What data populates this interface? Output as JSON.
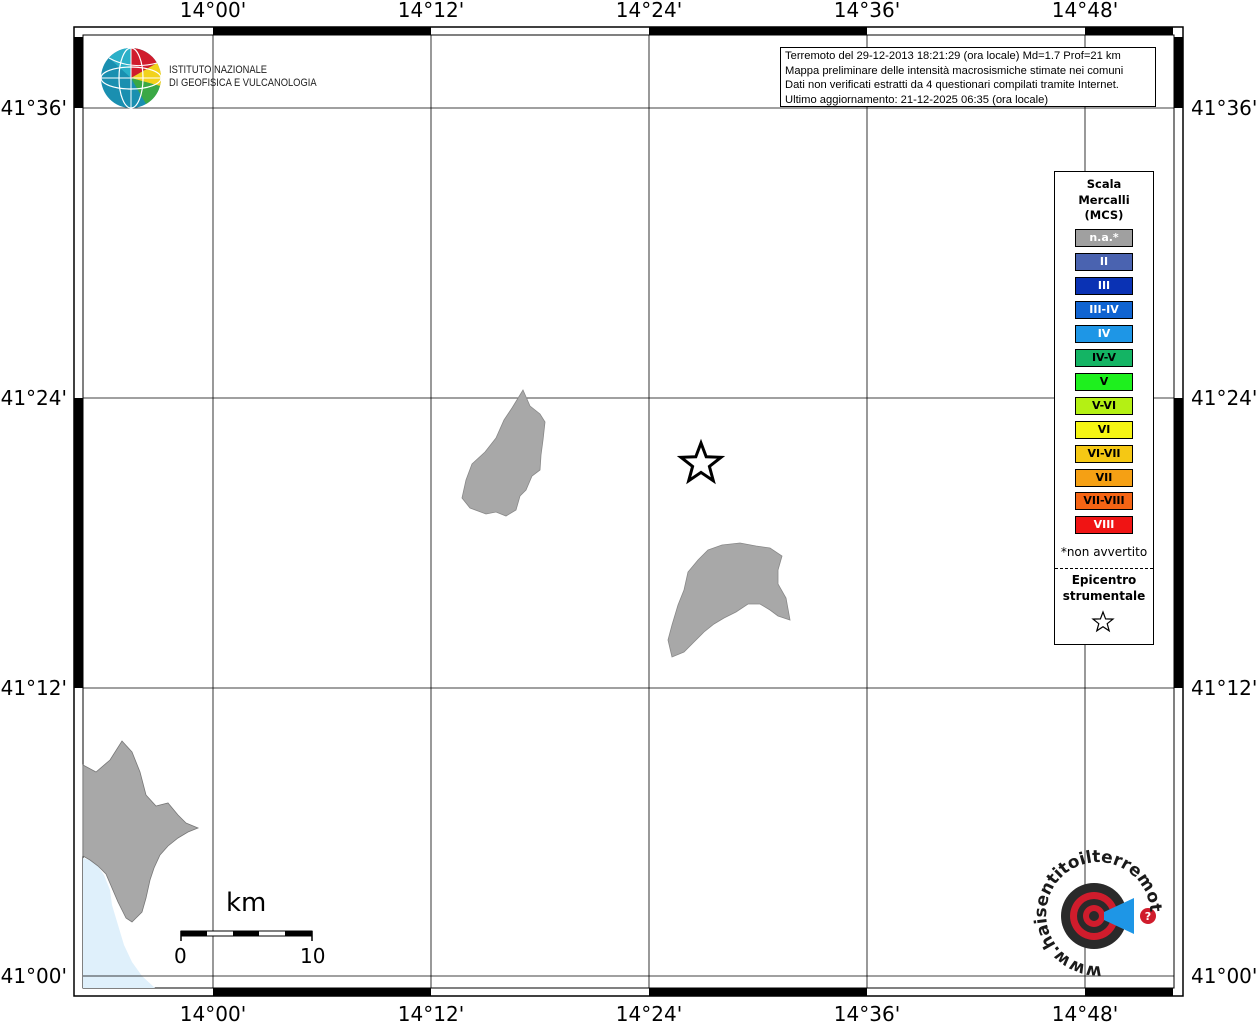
{
  "map": {
    "lon_labels": [
      "14°00'",
      "14°12'",
      "14°24'",
      "14°36'",
      "14°48'"
    ],
    "lat_labels": [
      "41°36'",
      "41°24'",
      "41°12'",
      "41°00'"
    ]
  },
  "header": {
    "institute_line1": "ISTITUTO NAZIONALE",
    "institute_line2": "DI GEOFISICA E VULCANOLOGIA"
  },
  "info": {
    "line1": "Terremoto del 29-12-2013 18:21:29 (ora locale) Md=1.7 Prof=21 km",
    "line2": "Mappa preliminare delle intensità macrosismiche stimate nei comuni",
    "line3": "Dati non verificati estratti da 4 questionari compilati tramite Internet.",
    "line4": "Ultimo aggiornamento: 21-12-2025 06:35 (ora locale)"
  },
  "legend": {
    "title_line1": "Scala",
    "title_line2": "Mercalli",
    "title_line3": "(MCS)",
    "items": [
      {
        "label": "n.a.*",
        "color": "#a0a0a0"
      },
      {
        "label": "II",
        "color": "#4a63b0"
      },
      {
        "label": "III",
        "color": "#0a32b4"
      },
      {
        "label": "III-IV",
        "color": "#0f64d2"
      },
      {
        "label": "IV",
        "color": "#1e96e6"
      },
      {
        "label": "IV-V",
        "color": "#14b464"
      },
      {
        "label": "V",
        "color": "#1ef01e"
      },
      {
        "label": "V-VI",
        "color": "#b4f014"
      },
      {
        "label": "VI",
        "color": "#f5f514"
      },
      {
        "label": "VI-VII",
        "color": "#f5c814"
      },
      {
        "label": "VII",
        "color": "#f5a014"
      },
      {
        "label": "VII-VIII",
        "color": "#f56414"
      },
      {
        "label": "VIII",
        "color": "#f01414"
      }
    ],
    "note": "*non avvertito",
    "epicenter_line1": "Epicentro",
    "epicenter_line2": "strumentale"
  },
  "scalebar": {
    "unit": "km",
    "start": "0",
    "end": "10"
  },
  "logo": {
    "text": "www.haisentitoilterremoto.it"
  },
  "colors": {
    "land": "#a8a8a8",
    "sea": "#dff0fb"
  }
}
